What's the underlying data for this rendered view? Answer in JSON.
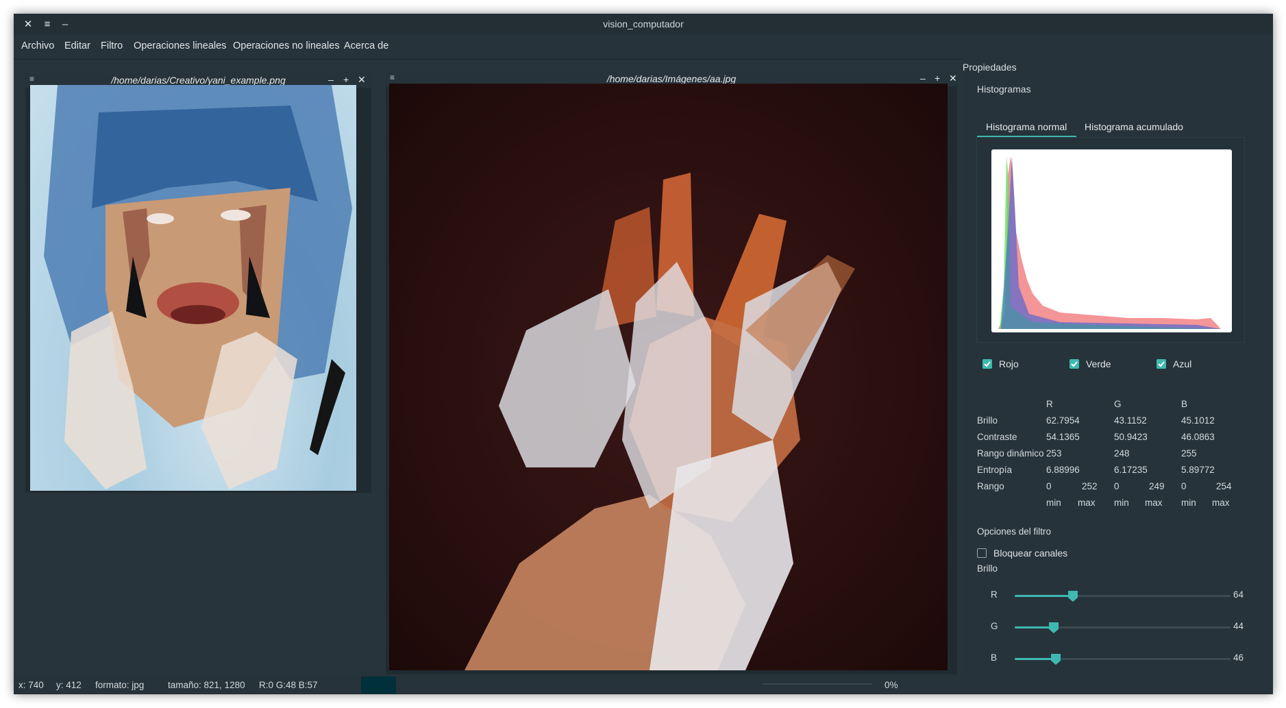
{
  "window": {
    "title": "vision_computador",
    "controls": {
      "close": "✕",
      "menu": "≡",
      "minimize": "–"
    }
  },
  "menubar": [
    "Archivo",
    "Editar",
    "Filtro",
    "Operaciones lineales",
    "Operaciones no lineales",
    "Acerca de"
  ],
  "subwindows": [
    {
      "title": "/home/darias/Creativo/yani_example.png",
      "menu": "≡",
      "minimize": "–",
      "maximize": "+",
      "close": "✕"
    },
    {
      "title": "/home/darias/Imágenes/aa.jpg",
      "menu": "≡",
      "minimize": "–",
      "maximize": "+",
      "close": "✕"
    }
  ],
  "dock": {
    "title": "Propiedades",
    "histograms_label": "Histogramas",
    "tabs": [
      "Histograma normal",
      "Histograma acumulado"
    ],
    "channels": [
      {
        "label": "Rojo",
        "checked": true
      },
      {
        "label": "Verde",
        "checked": true
      },
      {
        "label": "Azul",
        "checked": true
      }
    ],
    "stats": {
      "headers": [
        "R",
        "G",
        "B"
      ],
      "rows": [
        {
          "label": "Brillo",
          "values": [
            "62.7954",
            "43.1152",
            "45.1012"
          ]
        },
        {
          "label": "Contraste",
          "values": [
            "54.1365",
            "50.9423",
            "46.0863"
          ]
        },
        {
          "label": "Rango dinámico",
          "values": [
            "253",
            "248",
            "255"
          ]
        },
        {
          "label": "Entropía",
          "values": [
            "6.88996",
            "6.17235",
            "5.89772"
          ]
        }
      ],
      "rango": {
        "label": "Rango",
        "values": [
          "0",
          "252",
          "0",
          "249",
          "0",
          "254"
        ]
      },
      "minmax": [
        "min",
        "max",
        "min",
        "max",
        "min",
        "max"
      ]
    },
    "filter_options": {
      "title": "Opciones del filtro",
      "lock_label": "Bloquear canales",
      "lock_checked": false,
      "brightness_label": "Brillo",
      "sliders": [
        {
          "channel": "R",
          "value": "64",
          "fraction": 0.27
        },
        {
          "channel": "G",
          "value": "44",
          "fraction": 0.18
        },
        {
          "channel": "B",
          "value": "46",
          "fraction": 0.19
        }
      ]
    },
    "colors": {
      "accent": "#3fb8b0",
      "red": "#f0686c",
      "green": "#5fdc5a",
      "blue": "#3a5fd8"
    }
  },
  "status": {
    "x": "x: 740",
    "y": "y: 412",
    "format": "formato: jpg",
    "size": "tamaño: 821, 1280",
    "rgb": "R:0  G:48  B:57",
    "swatch_color": "#003039",
    "progress": "0%"
  }
}
